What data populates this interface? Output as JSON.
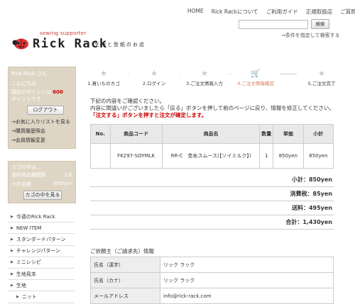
{
  "topnav": [
    "HOME",
    "Rick Rackについて",
    "ご利用ガイド",
    "正規取扱店",
    "ご質問"
  ],
  "search": {
    "button": "検索",
    "advanced": "→条件を指定して検索する"
  },
  "logo": {
    "tagline": "sewing supporter",
    "name": "Rick Rack",
    "subtitle": "生地と型紙のお店"
  },
  "account": {
    "name": "Rick Rack さん",
    "greeting": "こんにちは",
    "points_prefix": "現在のポイントは",
    "points_value": "600",
    "points_suffix": "ポイントです",
    "logout": "ログアウト",
    "links": [
      "→お気に入りリストを見る",
      "→購買履歴照会",
      "→会員情報変更"
    ]
  },
  "cart": {
    "title": "カゴの中は...",
    "count_label": "選択商品種類数",
    "count_value": "1点",
    "subtotal_label": "小計金額",
    "subtotal_value": "850yen",
    "view_button": "カゴの中を見る"
  },
  "menu": [
    {
      "label": "今週のRick Rack",
      "sub": false
    },
    {
      "label": "NEW ITEM",
      "sub": false
    },
    {
      "label": "スタンダードパターン",
      "sub": false
    },
    {
      "label": "チャレンジパターン",
      "sub": false
    },
    {
      "label": "ミニレシピ",
      "sub": false
    },
    {
      "label": "生地見本",
      "sub": false
    },
    {
      "label": "生地",
      "sub": false
    },
    {
      "label": "ニット",
      "sub": true
    }
  ],
  "steps": [
    {
      "label": "1.買いものカゴ",
      "active": false
    },
    {
      "label": "2.ログイン",
      "active": false
    },
    {
      "label": "3.ご注文情報入力",
      "active": false
    },
    {
      "label": "4.ご注文情報確認",
      "active": true
    },
    {
      "label": "5.ご注文完了",
      "active": false
    }
  ],
  "intro": {
    "line1": "下記の内容をご確認ください。",
    "line2": "内容に間違いがございましたら「戻る」ボタンを押して前のページに戻り、情報を修正してください。",
    "line3": "「注文する」ボタンを押すと注文が確定します。"
  },
  "order_table": {
    "headers": [
      "No.",
      "商品コード",
      "商品名",
      "数量",
      "単価",
      "小計"
    ],
    "rows": [
      {
        "no": "",
        "code": "FK297-SOYMLK",
        "name": "RR-C　杢糸スムース(【ソイミルク】)",
        "qty": "1",
        "price": "850yen",
        "subtotal": "850yen"
      }
    ]
  },
  "totals": {
    "subtotal": "小計：850yen",
    "tax": "消費税：85yen",
    "shipping": "送料：495yen",
    "total": "合計：1,430yen"
  },
  "client": {
    "title": "ご依頼主（ご請求先）情報",
    "rows": [
      {
        "k": "氏名（漢字）",
        "v": "リック ラック"
      },
      {
        "k": "氏名（カナ）",
        "v": "リック ラック"
      },
      {
        "k": "メールアドレス",
        "v": "info@rick-rack.com"
      }
    ]
  },
  "colors": {
    "sidebar_bg": "#ded5c4",
    "warning": "#cc0000",
    "active_step": "#e0785a",
    "logo_red": "#d33"
  }
}
